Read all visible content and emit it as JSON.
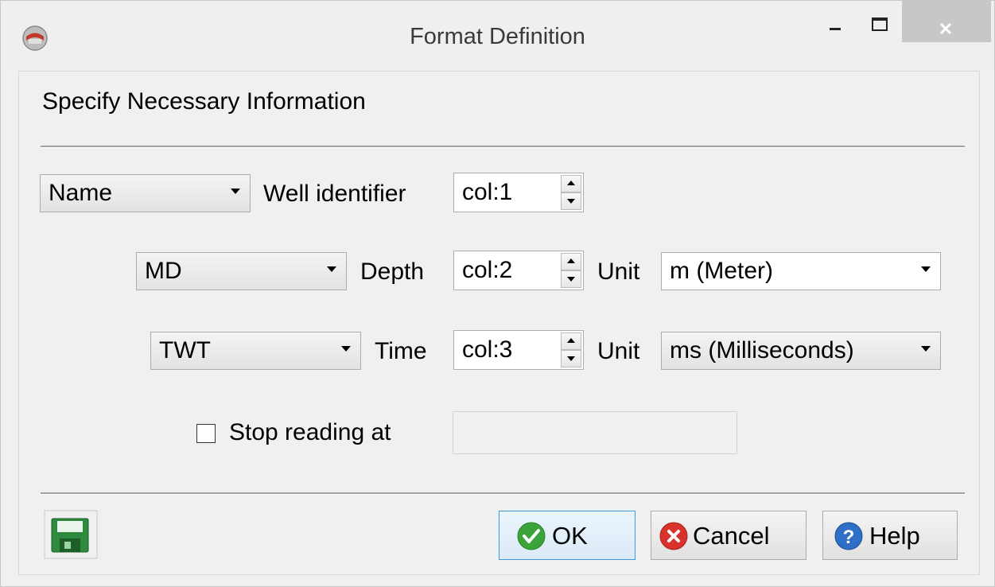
{
  "window": {
    "title": "Format Definition",
    "controls": {
      "minimize": "minimize",
      "maximize": "maximize",
      "close": "close"
    }
  },
  "header": {
    "label": "Specify Necessary Information"
  },
  "rows": {
    "identifier": {
      "type_value": "Name",
      "label": "Well identifier",
      "column_value": "col:1"
    },
    "depth": {
      "type_value": "MD",
      "label": "Depth",
      "column_value": "col:2",
      "unit_label": "Unit",
      "unit_value": "m (Meter)"
    },
    "time": {
      "type_value": "TWT",
      "label": "Time",
      "column_value": "col:3",
      "unit_label": "Unit",
      "unit_value": "ms (Milliseconds)"
    }
  },
  "stop_reading": {
    "label": "Stop reading at",
    "checked": false,
    "value": ""
  },
  "buttons": {
    "ok": "OK",
    "cancel": "Cancel",
    "help": "Help"
  },
  "icons": {
    "app": "app-icon",
    "save": "save-icon",
    "ok": "checkmark-icon",
    "cancel": "cancel-x-icon",
    "help": "question-icon"
  },
  "colors": {
    "ok_icon": "#3aa33a",
    "cancel_icon": "#d8322c",
    "help_icon": "#2f6fc8",
    "save_icon": "#2e8b3e",
    "default_button_border": "#3c9bdc",
    "close_button": "#c7c7c7"
  }
}
